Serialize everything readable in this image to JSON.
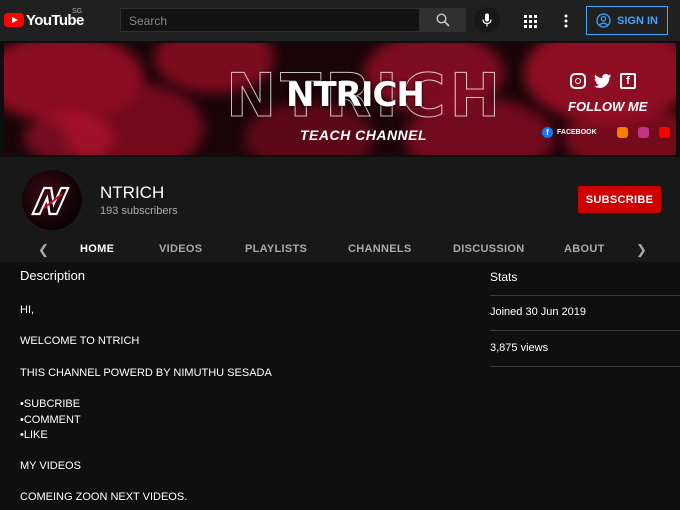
{
  "header": {
    "logo_text": "YouTube",
    "region": "SG",
    "search_placeholder": "Search",
    "signin_label": "SIGN IN"
  },
  "banner": {
    "title": "NTRICH",
    "subtitle": "TEACH CHANNEL",
    "follow": "FOLLOW ME",
    "facebook_label": "FACEBOOK",
    "colors": {
      "accent": "#c8102e",
      "background": "#1a0508"
    }
  },
  "channel": {
    "name": "NTRICH",
    "subscribers": "193 subscribers",
    "subscribe_label": "SUBSCRIBE",
    "avatar_letter": "N"
  },
  "tabs": [
    {
      "label": "HOME",
      "active": true
    },
    {
      "label": "VIDEOS"
    },
    {
      "label": "PLAYLISTS"
    },
    {
      "label": "CHANNELS"
    },
    {
      "label": "DISCUSSION"
    },
    {
      "label": "ABOUT"
    }
  ],
  "about": {
    "description_title": "Description",
    "lines": [
      "HI,",
      "WELCOME TO NTRICH",
      "THIS CHANNEL POWERD BY NIMUTHU SESADA",
      "•SUBCRIBE",
      "•COMMENT",
      "•LIKE",
      "MY VIDEOS",
      "COMEING ZOON NEXT VIDEOS."
    ]
  },
  "stats": {
    "title": "Stats",
    "joined": "Joined 30 Jun 2019",
    "views": "3,875 views"
  },
  "colors": {
    "subscribe": "#cc0000",
    "signin": "#3ea6ff",
    "page_bg": "#0f0f0f",
    "header_bg": "#202020"
  }
}
